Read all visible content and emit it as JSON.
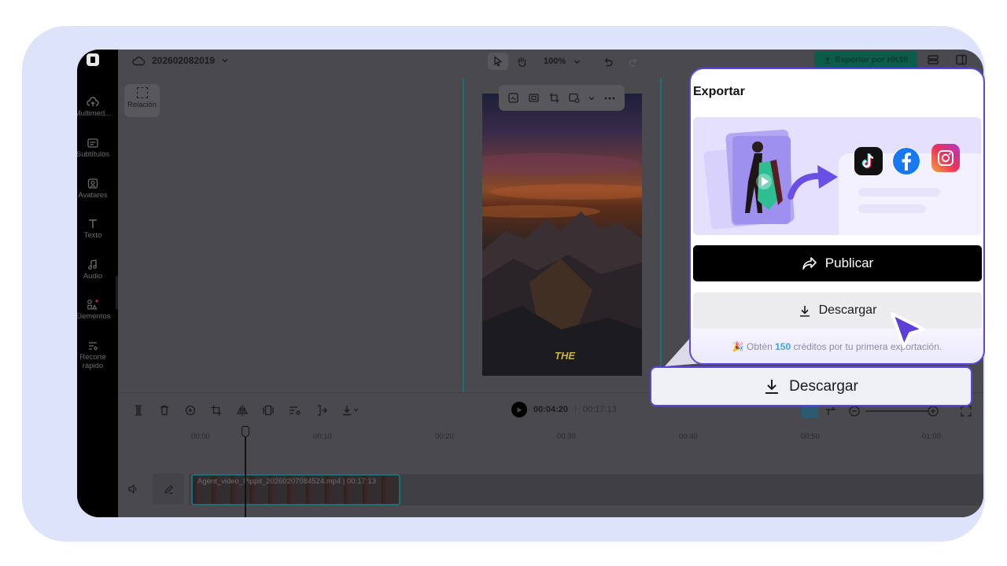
{
  "project": {
    "name": "202602082019"
  },
  "toolbar": {
    "zoom": "100%",
    "export_label": "Exportar por HK$0"
  },
  "rail": {
    "items": [
      {
        "label": "Multimed...",
        "icon": "cloud-upload-icon"
      },
      {
        "label": "Subtítulos",
        "icon": "subtitles-icon"
      },
      {
        "label": "Avatares",
        "icon": "avatar-icon"
      },
      {
        "label": "Texto",
        "icon": "text-icon"
      },
      {
        "label": "Audio",
        "icon": "music-note-icon"
      },
      {
        "label": "Elementos",
        "icon": "elements-icon"
      },
      {
        "label": "Recorte rápido",
        "icon": "quick-cut-icon"
      }
    ]
  },
  "canvas": {
    "ratio_label": "Relación",
    "preview_caption": "THE"
  },
  "timeline": {
    "current_time": "00:04:20",
    "separator": "|",
    "total_time": "00:17:13",
    "ticks": [
      "00:00",
      "00:10",
      "00:20",
      "00:30",
      "00:40",
      "00:50",
      "01:00"
    ],
    "clip_name": "Agent_video_Pippit_20260207084524.mp4",
    "clip_duration": "00:17:13"
  },
  "export_panel": {
    "title": "Exportar",
    "publish_label": "Publicar",
    "download_label": "Descargar",
    "promo_prefix": "Obtén",
    "promo_number": "150",
    "promo_suffix": "créditos por tu primera exportación."
  },
  "callout": {
    "label": "Descargar"
  },
  "colors": {
    "accent": "#5b45e0",
    "frame": "#dde3fb",
    "export": "#0c5c4a",
    "guide": "#1a6f78"
  }
}
